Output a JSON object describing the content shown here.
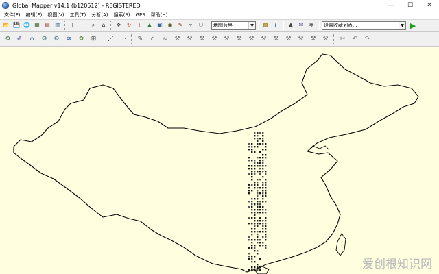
{
  "window": {
    "title": "Global Mapper v14.1 (b120512) - REGISTERED",
    "minimize_glyph": "—",
    "maximize_glyph": "☐",
    "close_glyph": "✕"
  },
  "menu": {
    "items": [
      "文件(F)",
      "编辑(E)",
      "视图(V)",
      "工具(T)",
      "分析(A)",
      "搜索(S)",
      "GPS",
      "帮助(H)"
    ]
  },
  "toolbar1": {
    "icon_glyphs": {
      "open": "📂",
      "save": "💾",
      "globe": "🌐",
      "grid": "▦",
      "image": "▤",
      "map": "▥",
      "zoom_in": "+",
      "zoom_out": "−",
      "search": "⌕",
      "home": "⌂",
      "pan": "✥",
      "measure": "↻",
      "lasso": "⌇",
      "terrain": "▲",
      "photo": "▣",
      "camera": "◉",
      "vector": "✎",
      "filter": "▿",
      "binoculars": "⚇",
      "layers": "▩",
      "info": "i",
      "figure": "♟",
      "note": "✉",
      "star": "✱"
    },
    "layer_combo_value": "地图蓝黑",
    "view_combo_value": "设置收藏列表...",
    "combo_arrow": "▼",
    "go_glyph": "▶"
  },
  "toolbar2": {
    "icon_glyphs": [
      "⟲",
      "✐",
      "⌂",
      "⚙",
      "⚙",
      "≋",
      "✿",
      "⊞",
      "⋰",
      "⋯",
      "✎",
      "⌂",
      "≈",
      "⚒",
      "⚒",
      "⚒",
      "⚒",
      "⚒",
      "⚒",
      "⚒",
      "⚒",
      "⚒",
      "⚒",
      "⚒",
      "⚒",
      "⚒",
      "✂",
      "↶",
      "↷"
    ]
  },
  "colors": {
    "map_background": "#ffffe0",
    "boundary": "#000000",
    "go_button": "#1e9e1e"
  },
  "watermark": "爱创根知识网"
}
